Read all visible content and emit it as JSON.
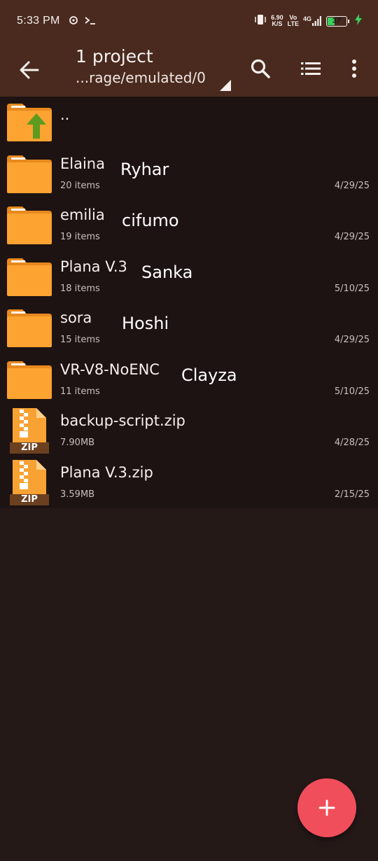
{
  "status_bar": {
    "time": "5:33 PM",
    "speed_value": "6.90",
    "speed_unit": "K/S",
    "volte_top": "Vo",
    "volte_bottom": "LTE",
    "network": "4G",
    "battery_level": "37",
    "battery_fraction": 0.37
  },
  "toolbar": {
    "title": "1 project",
    "path": "...rage/emulated/0",
    "icons": [
      "back-arrow-icon",
      "search-icon",
      "list-view-icon",
      "more-vert-icon"
    ]
  },
  "files": [
    {
      "name": "..",
      "type": "parent",
      "meta": "",
      "date": "",
      "tag": ""
    },
    {
      "name": "Elaina",
      "type": "folder",
      "meta": "20 items",
      "date": "4/29/25",
      "tag": "Ryhar"
    },
    {
      "name": "emilia",
      "type": "folder",
      "meta": "19 items",
      "date": "4/29/25",
      "tag": "cifumo"
    },
    {
      "name": "Plana V.3",
      "type": "folder",
      "meta": "18 items",
      "date": "5/10/25",
      "tag": "Sanka"
    },
    {
      "name": "sora",
      "type": "folder",
      "meta": "15 items",
      "date": "4/29/25",
      "tag": "Hoshi"
    },
    {
      "name": "VR-V8-NoENC",
      "type": "folder",
      "meta": "11 items",
      "date": "5/10/25",
      "tag": "Clayza"
    },
    {
      "name": "backup-script.zip",
      "type": "zip",
      "meta": "7.90MB",
      "date": "4/28/25",
      "tag": ""
    },
    {
      "name": "Plana V.3.zip",
      "type": "zip",
      "meta": "3.59MB",
      "date": "2/15/25",
      "tag": ""
    }
  ],
  "zip_label": "ZIP",
  "fab": {
    "icon": "plus-icon"
  },
  "colors": {
    "toolbar_bg": "#4a2a1e",
    "background": "#251918",
    "row_bg": "#1d1312",
    "folder": "#fca331",
    "fab": "#f04e5a"
  }
}
